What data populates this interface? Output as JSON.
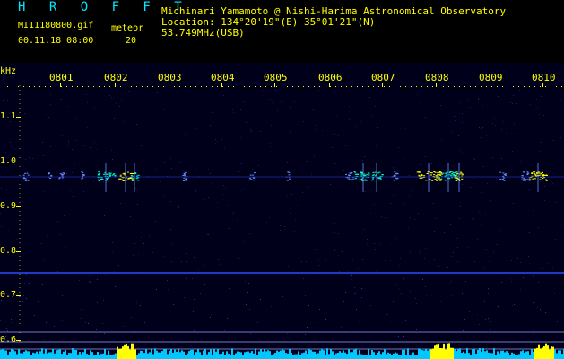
{
  "window": {
    "brand": "H R O F F T",
    "filename": "MI11180800.gif",
    "datetime": "00.11.18 08:00",
    "meteor_label": "meteor",
    "meteor_count": "20",
    "author": "Michinari Yamamoto @ Nishi-Harima Astronomical Observatory",
    "location": "Location: 134°20'19\"(E) 35°01'21\"(N)",
    "frequency": "53.749MHz(USB)",
    "unit": "kHz"
  },
  "axis": {
    "time_ticks": [
      "0801",
      "0802",
      "0803",
      "0804",
      "0805",
      "0806",
      "0807",
      "0808",
      "0809",
      "0810"
    ],
    "freq_ticks": [
      "1.1",
      "1.0",
      "0.9",
      "0.8",
      "0.7",
      "0.6"
    ]
  },
  "colors": {
    "background": "#00001a",
    "header_text": "#ffff00",
    "brand": "#00e8ff",
    "trace": "#2a4cff",
    "echo_hot": "#ffff00",
    "echo_warm": "#00ffc8",
    "noise_floor": "#00c8ff"
  }
}
